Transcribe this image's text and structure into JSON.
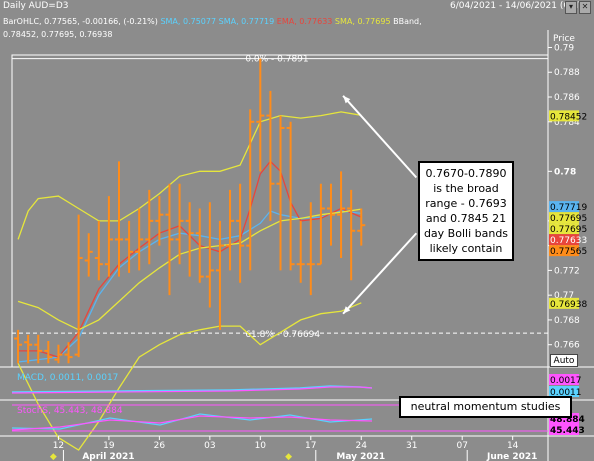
{
  "header": {
    "title": "Daily AUD=D3",
    "range": "6/04/2021 - 14/06/2021 (GMT)"
  },
  "legend": {
    "line1": [
      {
        "text": "BarOHLC, 0.77565, -0.00166, (-0.21%)",
        "color": "#ffffff"
      },
      {
        "text": "SMA, 0.75077",
        "color": "#5ad2ff"
      },
      {
        "text": "SMA, 0.77719",
        "color": "#5ad2ff"
      },
      {
        "text": "EMA, 0.77633",
        "color": "#e8453c"
      },
      {
        "text": "SMA, 0.77695",
        "color": "#e6e63c"
      },
      {
        "text": "BBand,",
        "color": "#ffffff"
      }
    ],
    "line2": "0.78452, 0.77695, 0.76938"
  },
  "colors": {
    "background": "#8c8c8c",
    "bars": "#ff8c1a",
    "sma_blue": "#5ab4f0",
    "ema_red": "#e8453c",
    "bband": "#e6e63c",
    "macd": "#5ad2ff",
    "macd_signal": "#ff55ff",
    "stoch_k": "#ff55ff",
    "stoch_d": "#5ad2ff"
  },
  "chart_data": {
    "type": "ohlc",
    "price_axis_label": "Price",
    "y_ticks": [
      "0.79",
      "0.788",
      "0.786",
      "0.784",
      "0.78",
      "0.776",
      "0.774",
      "0.772",
      "0.77",
      "0.768",
      "0.766"
    ],
    "ylim": [
      0.7642,
      0.7902
    ],
    "x_tick_labels": [
      {
        "day": 0,
        "label": "12"
      },
      {
        "day": 5,
        "label": "19"
      },
      {
        "day": 10,
        "label": "26"
      },
      {
        "day": 15,
        "label": "03"
      },
      {
        "day": 20,
        "label": "10"
      },
      {
        "day": 25,
        "label": "17"
      },
      {
        "day": 30,
        "label": "24"
      },
      {
        "day": 35,
        "label": "31"
      },
      {
        "day": 40,
        "label": "07"
      },
      {
        "day": 45,
        "label": "14"
      }
    ],
    "month_labels": [
      {
        "day": 0,
        "label": "April 2021"
      },
      {
        "day": 25,
        "label": "May 2021"
      },
      {
        "day": 40,
        "label": "June 2021"
      }
    ],
    "xlim": [
      -4.6,
      48.5
    ],
    "ohlc": [
      [
        -4,
        0.7665,
        0.7672,
        0.7645,
        0.766
      ],
      [
        -3,
        0.7662,
        0.7668,
        0.7645,
        0.766
      ],
      [
        -2,
        0.766,
        0.7668,
        0.7645,
        0.7655
      ],
      [
        -1,
        0.7655,
        0.7663,
        0.7645,
        0.765
      ],
      [
        0,
        0.7648,
        0.766,
        0.7645,
        0.7652
      ],
      [
        1,
        0.7652,
        0.7662,
        0.7645,
        0.765
      ],
      [
        2,
        0.7652,
        0.7765,
        0.765,
        0.773
      ],
      [
        3,
        0.7728,
        0.775,
        0.7715,
        0.7735
      ],
      [
        4,
        0.773,
        0.776,
        0.7712,
        0.7725
      ],
      [
        5,
        0.7725,
        0.778,
        0.7715,
        0.7745
      ],
      [
        6,
        0.7745,
        0.7808,
        0.7715,
        0.7745
      ],
      [
        7,
        0.7745,
        0.776,
        0.7718,
        0.7735
      ],
      [
        8,
        0.7735,
        0.777,
        0.772,
        0.7745
      ],
      [
        9,
        0.7745,
        0.7785,
        0.7725,
        0.776
      ],
      [
        10,
        0.776,
        0.778,
        0.774,
        0.7765
      ],
      [
        11,
        0.7765,
        0.779,
        0.77,
        0.7745
      ],
      [
        12,
        0.7745,
        0.779,
        0.7725,
        0.776
      ],
      [
        13,
        0.776,
        0.7775,
        0.7715,
        0.775
      ],
      [
        14,
        0.775,
        0.777,
        0.771,
        0.7715
      ],
      [
        15,
        0.7715,
        0.7775,
        0.769,
        0.772
      ],
      [
        16,
        0.772,
        0.776,
        0.7672,
        0.774
      ],
      [
        17,
        0.774,
        0.7785,
        0.772,
        0.776
      ],
      [
        18,
        0.776,
        0.779,
        0.771,
        0.774
      ],
      [
        19,
        0.774,
        0.785,
        0.772,
        0.784
      ],
      [
        20,
        0.784,
        0.7891,
        0.78,
        0.7845
      ],
      [
        21,
        0.7845,
        0.7865,
        0.776,
        0.779
      ],
      [
        22,
        0.779,
        0.7845,
        0.772,
        0.7835
      ],
      [
        23,
        0.7835,
        0.784,
        0.772,
        0.7725
      ],
      [
        24,
        0.7725,
        0.776,
        0.771,
        0.7725
      ],
      [
        25,
        0.7725,
        0.7775,
        0.77,
        0.7725
      ],
      [
        26,
        0.7725,
        0.779,
        0.7725,
        0.777
      ],
      [
        27,
        0.777,
        0.779,
        0.774,
        0.7765
      ],
      [
        28,
        0.7765,
        0.78,
        0.773,
        0.777
      ],
      [
        29,
        0.777,
        0.7785,
        0.7712,
        0.7752
      ],
      [
        30,
        0.7752,
        0.777,
        0.774,
        0.77565
      ]
    ],
    "series": [
      {
        "name": "SMA, 0.75077",
        "x": [
          -4,
          -2,
          0,
          2,
          4,
          6,
          8,
          10,
          12,
          14,
          16,
          18,
          20,
          21,
          22,
          24,
          26,
          28,
          30
        ],
        "y": [
          0.7646,
          0.7648,
          0.765,
          0.7665,
          0.77,
          0.7722,
          0.7735,
          0.7745,
          0.775,
          0.7748,
          0.7745,
          0.7748,
          0.7758,
          0.7768,
          0.7765,
          0.7762,
          0.7763,
          0.7768,
          0.7766
        ]
      },
      {
        "name": "EMA, 0.77633",
        "x": [
          -4,
          -2,
          0,
          2,
          4,
          6,
          8,
          10,
          12,
          14,
          16,
          18,
          19,
          20,
          21,
          22,
          23,
          24,
          26,
          28,
          30
        ],
        "y": [
          0.7655,
          0.7655,
          0.765,
          0.767,
          0.7705,
          0.7725,
          0.7738,
          0.775,
          0.7756,
          0.774,
          0.7735,
          0.7745,
          0.777,
          0.7798,
          0.7808,
          0.78,
          0.7775,
          0.776,
          0.7762,
          0.777,
          0.7763
        ]
      },
      {
        "name": "BBand upper, 0.78452",
        "x": [
          -4,
          -3,
          -2,
          0,
          2,
          4,
          6,
          8,
          10,
          12,
          14,
          16,
          18,
          20,
          22,
          24,
          26,
          28,
          30
        ],
        "y": [
          0.7745,
          0.7768,
          0.7778,
          0.778,
          0.777,
          0.776,
          0.776,
          0.777,
          0.7782,
          0.7796,
          0.78,
          0.78,
          0.7805,
          0.784,
          0.7845,
          0.7843,
          0.7845,
          0.7848,
          0.78452
        ]
      },
      {
        "name": "BBand middle (SMA), 0.77695",
        "x": [
          -4,
          -2,
          0,
          2,
          4,
          6,
          8,
          10,
          12,
          14,
          16,
          18,
          20,
          22,
          24,
          26,
          28,
          30
        ],
        "y": [
          0.7695,
          0.769,
          0.768,
          0.7672,
          0.768,
          0.7695,
          0.771,
          0.7722,
          0.7733,
          0.7738,
          0.774,
          0.7742,
          0.7752,
          0.776,
          0.7762,
          0.7765,
          0.7767,
          0.77695
        ]
      },
      {
        "name": "BBand lower, 0.76938",
        "x": [
          -4,
          -2,
          0,
          2,
          4,
          6,
          8,
          10,
          12,
          14,
          16,
          18,
          20,
          22,
          24,
          26,
          28,
          30
        ],
        "y": [
          0.7645,
          0.7612,
          0.7585,
          0.7575,
          0.7598,
          0.7625,
          0.765,
          0.766,
          0.7668,
          0.7672,
          0.7675,
          0.7675,
          0.766,
          0.767,
          0.768,
          0.7685,
          0.7687,
          0.76938
        ]
      }
    ],
    "fib_levels": [
      {
        "label": "0.0% - 0.7891",
        "value": 0.7891
      },
      {
        "label": "61.8% - 0.76694",
        "value": 0.76694
      }
    ],
    "price_labels": [
      {
        "text": "0.78452",
        "value": 0.78452,
        "bg": "#e6e63c",
        "fg": "#000000"
      },
      {
        "text": "0.77719",
        "value": 0.77719,
        "bg": "#5ab4f0",
        "fg": "#000000"
      },
      {
        "text": "0.77695",
        "value": 0.77695,
        "bg": "#e6e63c",
        "fg": "#000000"
      },
      {
        "text": "0.77695",
        "value": 0.77695,
        "bg": "#e6e63c",
        "fg": "#000000"
      },
      {
        "text": "0.77633",
        "value": 0.77633,
        "bg": "#e8453c",
        "fg": "#ffffff"
      },
      {
        "text": "0.77565",
        "value": 0.77565,
        "bg": "#ff8c1a",
        "fg": "#000000"
      },
      {
        "text": "0.76938",
        "value": 0.76938,
        "bg": "#e6e63c",
        "fg": "#000000"
      }
    ],
    "annotations": {
      "callout_main": "0.7670-0.7890 is the broad range - 0.7693 and 0.7845 21 day Bolli bands likely contain",
      "callout_momentum": "neutral momentum studies",
      "arrows": [
        {
          "from_day": 31,
          "from_price": 0.7795,
          "to_day": 28.2,
          "to_price": 0.7861
        },
        {
          "from_day": 31,
          "from_price": 0.775,
          "to_day": 28.2,
          "to_price": 0.7685
        }
      ]
    },
    "auto_button": "Auto",
    "macd": {
      "label": "MACD, 0.0011, 0.0017",
      "value": 0.0011,
      "signal": 0.0017,
      "value_tags": [
        "0.0017",
        "0.0011"
      ]
    },
    "stoch": {
      "label": "StochS, 45.443, 48.884",
      "k": 45.443,
      "d": 48.884,
      "value_tags": [
        "48.884",
        "45.443"
      ]
    }
  }
}
